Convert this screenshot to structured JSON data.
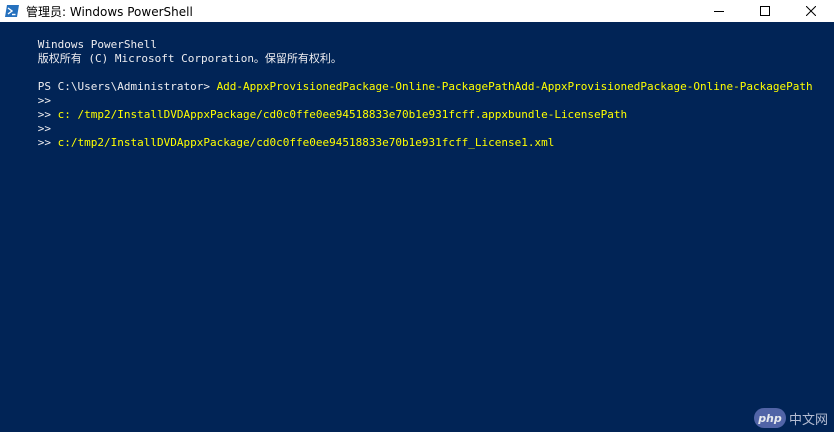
{
  "window": {
    "title": "管理员: Windows PowerShell",
    "app_icon": "powershell-icon",
    "controls": [
      "minimize-icon",
      "maximize-icon",
      "close-icon"
    ]
  },
  "console": {
    "colors": {
      "background": "#012456",
      "text": "#eeedf0",
      "command": "#ffff00"
    },
    "lines": [
      {
        "text": "Windows PowerShell"
      },
      {
        "text": "版权所有 (C) Microsoft Corporation。保留所有权利。"
      },
      {
        "text": ""
      },
      {
        "prompt": "PS C:\\Users\\Administrator> ",
        "command": "Add-AppxProvisionedPackage-Online-PackagePathAdd-AppxProvisionedPackage-Online-PackagePath"
      },
      {
        "prompt": ">> "
      },
      {
        "prompt": ">> ",
        "command": "c: /tmp2/InstallDVDAppxPackage/cd0c0ffe0ee94518833e70b1e931fcff.appxbundle-LicensePath"
      },
      {
        "prompt": ">> "
      },
      {
        "prompt": ">> ",
        "command": "c:/tmp2/InstallDVDAppxPackage/cd0c0ffe0ee94518833e70b1e931fcff_License1.xml"
      }
    ]
  },
  "watermark": {
    "logo_text": "php",
    "site_text": "中文网"
  }
}
